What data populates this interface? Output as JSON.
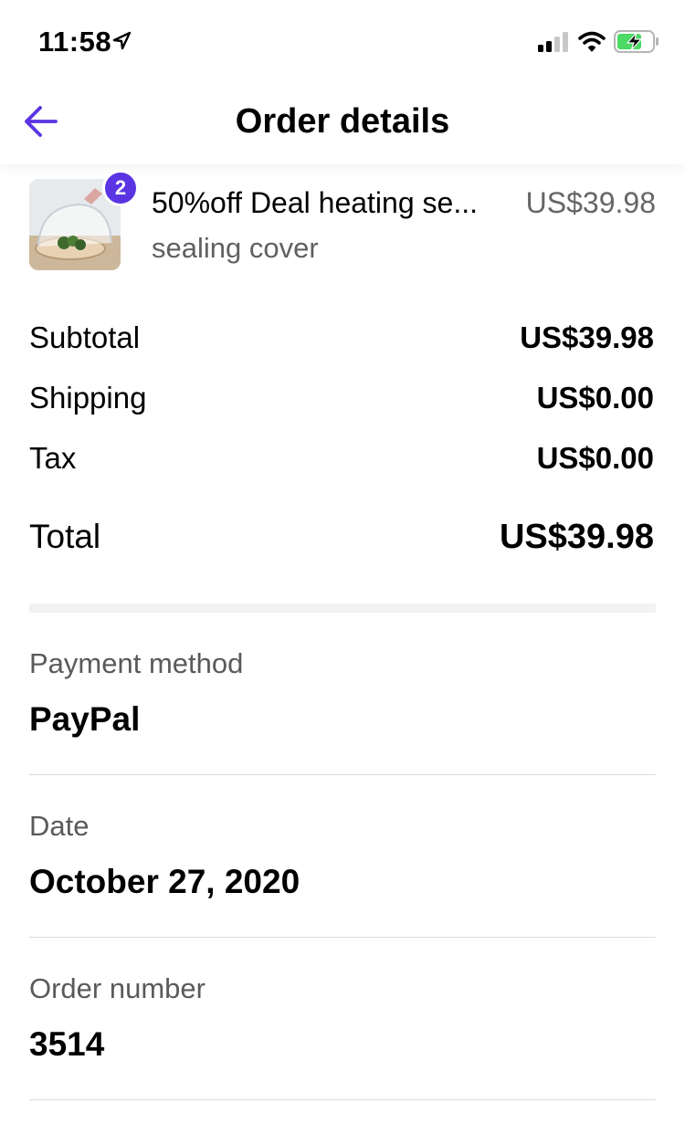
{
  "status_bar": {
    "time": "11:58"
  },
  "nav": {
    "title": "Order details",
    "accent_color": "#5b35e3"
  },
  "product": {
    "quantity": "2",
    "name": "50%off Deal heating se...",
    "variant": "sealing cover",
    "price": "US$39.98"
  },
  "summary": {
    "subtotal_label": "Subtotal",
    "subtotal_value": "US$39.98",
    "shipping_label": "Shipping",
    "shipping_value": "US$0.00",
    "tax_label": "Tax",
    "tax_value": "US$0.00",
    "total_label": "Total",
    "total_value": "US$39.98"
  },
  "details": {
    "payment_label": "Payment method",
    "payment_value": "PayPal",
    "date_label": "Date",
    "date_value": "October 27, 2020",
    "order_label": "Order number",
    "order_value": "3514"
  }
}
